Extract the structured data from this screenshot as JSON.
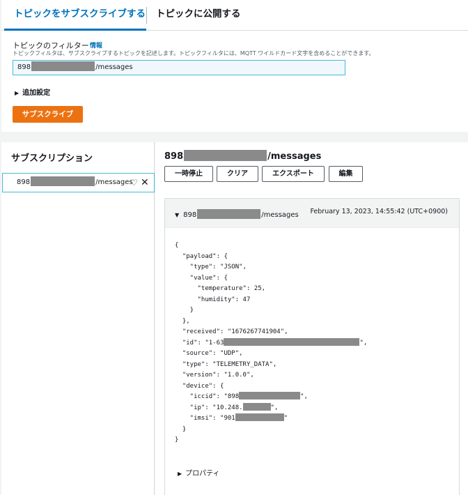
{
  "tabs": {
    "subscribe": "トピックをサブスクライブする",
    "publish": "トピックに公開する"
  },
  "filter": {
    "label": "トピックのフィルター",
    "info": "情報",
    "description": "トピックフィルタは、サブスクライブするトピックを記述します。トピックフィルタには、MQTT ワイルドカード文字を含めることができます。",
    "value_prefix": "898",
    "value_suffix": "/messages"
  },
  "additional_settings": "追加設定",
  "subscribe_button": "サブスクライブ",
  "subscriptions": {
    "title": "サブスクリプション",
    "item_prefix": "898",
    "item_suffix": "/messages"
  },
  "topic_view": {
    "title_prefix": "898",
    "title_suffix": "/messages",
    "buttons": {
      "pause": "一時停止",
      "clear": "クリア",
      "export": "エクスポート",
      "edit": "編集"
    }
  },
  "message": {
    "topic_prefix": "898",
    "topic_suffix": "/messages",
    "timestamp": "February 13, 2023, 14:55:42 (UTC+0900)",
    "json": {
      "l1": "{",
      "l2": "  \"payload\": {",
      "l3": "    \"type\": \"JSON\",",
      "l4": "    \"value\": {",
      "l5": "      \"temperature\": 25,",
      "l6": "      \"humidity\": 47",
      "l7": "    }",
      "l8": "  },",
      "l9": "  \"received\": \"1676267741904\",",
      "l10a": "  \"id\": \"1-63",
      "l10b": "\",",
      "l11": "  \"source\": \"UDP\",",
      "l12": "  \"type\": \"TELEMETRY_DATA\",",
      "l13": "  \"version\": \"1.0.0\",",
      "l14": "  \"device\": {",
      "l15a": "    \"iccid\": \"898",
      "l15b": "\",",
      "l16a": "    \"ip\": \"10.248.",
      "l16b": "\",",
      "l17a": "    \"imsi\": \"901",
      "l17b": "\"",
      "l18": "  }",
      "l19": "}"
    },
    "properties": "プロパティ"
  },
  "colors": {
    "accent": "#0073bb",
    "primary_button": "#ec7211",
    "input_border": "#44b9d6"
  }
}
